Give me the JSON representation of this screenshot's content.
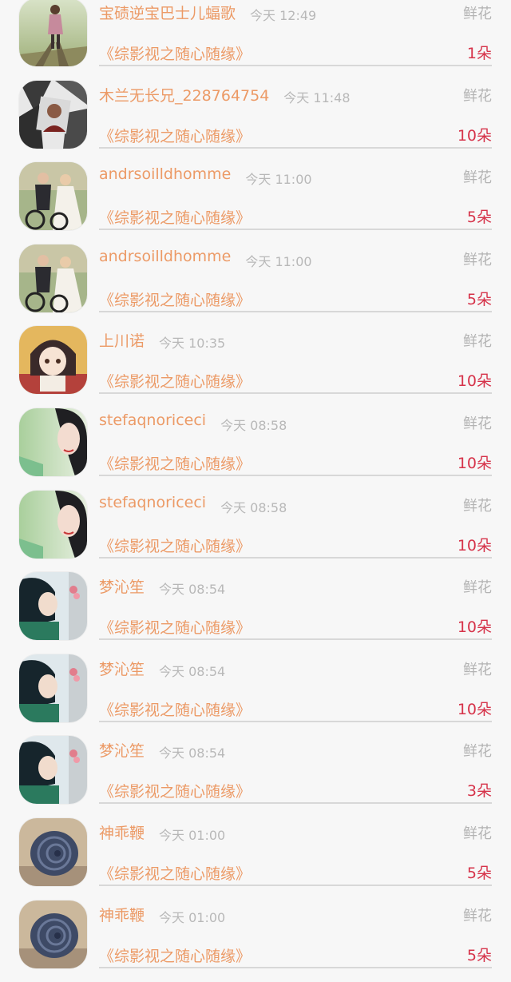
{
  "gift_list": {
    "rows": [
      {
        "user": "宝碛逆宝巴士儿蝠歌",
        "time": "今天 12:49",
        "gift": "鲜花",
        "work": "《综影视之随心随缘》",
        "count": "1朵",
        "avatar_icon": "girl-on-railway-avatar"
      },
      {
        "user": "木兰无长兄_228764754",
        "time": "今天 11:48",
        "gift": "鲜花",
        "work": "《综影视之随心随缘》",
        "count": "10朵",
        "avatar_icon": "photo-collage-avatar"
      },
      {
        "user": "andrsoilldhomme",
        "time": "今天 11:00",
        "gift": "鲜花",
        "work": "《综影视之随心随缘》",
        "count": "5朵",
        "avatar_icon": "wedding-bicycle-avatar"
      },
      {
        "user": "andrsoilldhomme",
        "time": "今天 11:00",
        "gift": "鲜花",
        "work": "《综影视之随心随缘》",
        "count": "5朵",
        "avatar_icon": "wedding-bicycle-avatar"
      },
      {
        "user": "上川诺",
        "time": "今天 10:35",
        "gift": "鲜花",
        "work": "《综影视之随心随缘》",
        "count": "10朵",
        "avatar_icon": "anime-girl-avatar"
      },
      {
        "user": "stefaqnoriceci",
        "time": "今天 08:58",
        "gift": "鲜花",
        "work": "《综影视之随心随缘》",
        "count": "10朵",
        "avatar_icon": "woman-portrait-avatar"
      },
      {
        "user": "stefaqnoriceci",
        "time": "今天 08:58",
        "gift": "鲜花",
        "work": "《综影视之随心随缘》",
        "count": "10朵",
        "avatar_icon": "woman-portrait-avatar"
      },
      {
        "user": "梦沁笙",
        "time": "今天 08:54",
        "gift": "鲜花",
        "work": "《综影视之随心随缘》",
        "count": "10朵",
        "avatar_icon": "girl-with-flower-avatar"
      },
      {
        "user": "梦沁笙",
        "time": "今天 08:54",
        "gift": "鲜花",
        "work": "《综影视之随心随缘》",
        "count": "10朵",
        "avatar_icon": "girl-with-flower-avatar"
      },
      {
        "user": "梦沁笙",
        "time": "今天 08:54",
        "gift": "鲜花",
        "work": "《综影视之随心随缘》",
        "count": "3朵",
        "avatar_icon": "girl-with-flower-avatar"
      },
      {
        "user": "神乖鞭",
        "time": "今天 01:00",
        "gift": "鲜花",
        "work": "《综影视之随心随缘》",
        "count": "5朵",
        "avatar_icon": "snail-shell-avatar"
      },
      {
        "user": "神乖鞭",
        "time": "今天 01:00",
        "gift": "鲜花",
        "work": "《综影视之随心随缘》",
        "count": "5朵",
        "avatar_icon": "snail-shell-avatar"
      }
    ]
  },
  "colors": {
    "username": "#ec9a66",
    "time": "#b8b8b8",
    "gift_type": "#b3b3b3",
    "work_title": "#ec9a66",
    "count": "#d6334a",
    "divider": "#d8d8d8",
    "background": "#f7f7f7"
  }
}
